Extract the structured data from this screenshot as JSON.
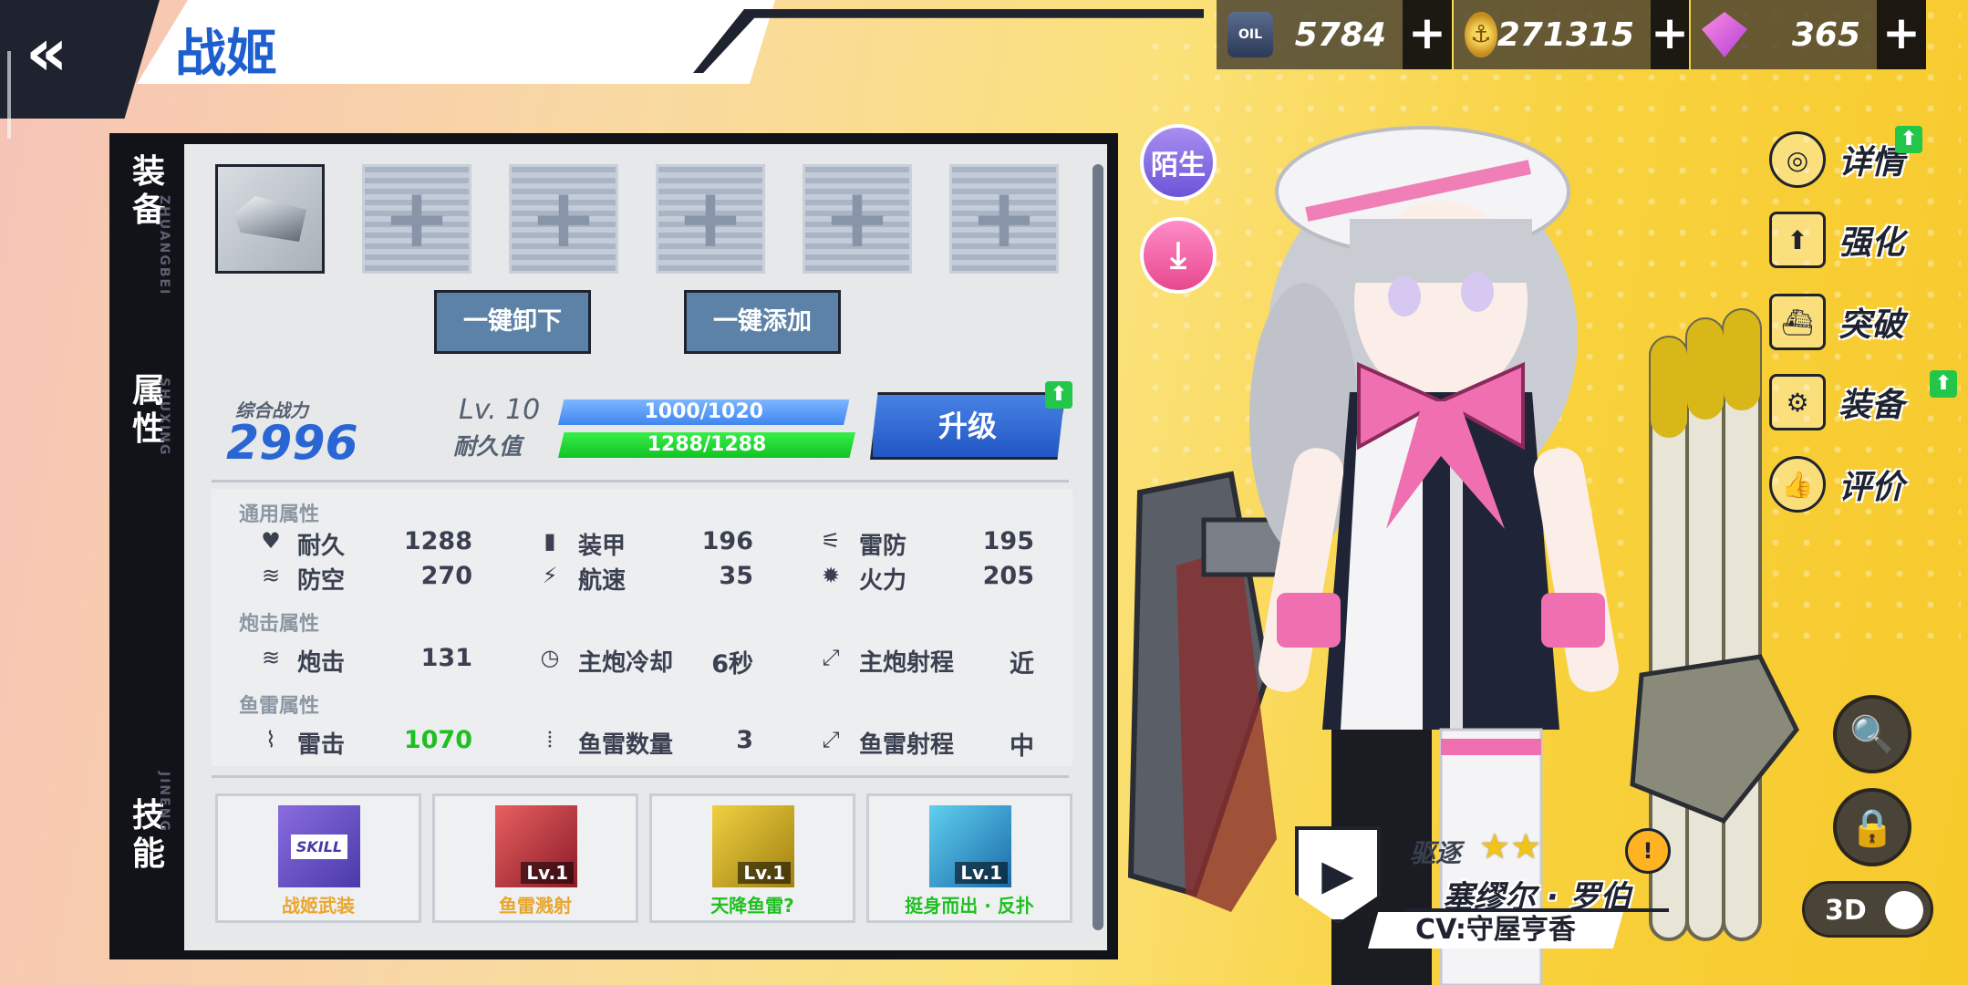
{
  "header": {
    "back_icon": "«",
    "title": "战姬"
  },
  "currencies": [
    {
      "icon": "oil-barrel-icon",
      "icon_text": "OIL",
      "value": "5784",
      "plus": "+"
    },
    {
      "icon": "gold-coin-icon",
      "icon_text": "⚓",
      "value": "271315",
      "plus": "+"
    },
    {
      "icon": "gem-icon",
      "icon_text": "",
      "value": "365",
      "plus": "+"
    }
  ],
  "side_tabs": [
    {
      "label": "装\n备",
      "pinyin": "ZHUANGBEI"
    },
    {
      "label": "属\n性",
      "pinyin": "SHUXING"
    },
    {
      "label": "技\n能",
      "pinyin": "JINENG"
    }
  ],
  "equipment": {
    "slots": [
      "filled",
      "+",
      "+",
      "+",
      "+",
      "+"
    ],
    "unequip_all": "一键卸下",
    "equip_all": "一键添加"
  },
  "stats_header": {
    "power_label": "综合战力",
    "power_value": "2996",
    "level": "Lv. 10",
    "exp": "1000/1020",
    "exp_fraction": 0.98,
    "durability_label": "耐久值",
    "hp": "1288/1288",
    "hp_fraction": 1.0,
    "upgrade": "升级",
    "arrow": "⬆"
  },
  "stat_groups": {
    "general": {
      "title": "通用属性",
      "rows": [
        [
          {
            "icon": "♥",
            "name": "耐久",
            "value": "1288"
          },
          {
            "icon": "▮",
            "name": "装甲",
            "value": "196"
          },
          {
            "icon": "⚟",
            "name": "雷防",
            "value": "195"
          }
        ],
        [
          {
            "icon": "≋",
            "name": "防空",
            "value": "270"
          },
          {
            "icon": "⚡",
            "name": "航速",
            "value": "35"
          },
          {
            "icon": "✹",
            "name": "火力",
            "value": "205"
          }
        ]
      ]
    },
    "gun": {
      "title": "炮击属性",
      "rows": [
        [
          {
            "icon": "≋",
            "name": "炮击",
            "value": "131"
          },
          {
            "icon": "◷",
            "name": "主炮冷却",
            "value": "6秒"
          },
          {
            "icon": "⤢",
            "name": "主炮射程",
            "value": "近"
          }
        ]
      ]
    },
    "torpedo": {
      "title": "鱼雷属性",
      "rows": [
        [
          {
            "icon": "⌇",
            "name": "雷击",
            "value": "1070"
          },
          {
            "icon": "⦙",
            "name": "鱼雷数量",
            "value": "3"
          },
          {
            "icon": "⤢",
            "name": "鱼雷射程",
            "value": "中"
          }
        ]
      ]
    }
  },
  "skills": [
    {
      "name": "战姬武装",
      "lv": "",
      "icon_text": "SKILL",
      "name_color": "#e8a62e"
    },
    {
      "name": "鱼雷溅射",
      "lv": "Lv.1",
      "icon_text": "",
      "name_color": "#e8a62e"
    },
    {
      "name": "天降鱼雷?",
      "lv": "Lv.1",
      "icon_text": "",
      "name_color": "#1fbf22"
    },
    {
      "name": "挺身而出 · 反扑",
      "lv": "Lv.1",
      "icon_text": "",
      "name_color": "#1fbf22"
    }
  ],
  "side_buttons": {
    "stranger": "陌生",
    "share_icon": "⤓"
  },
  "right_menu": [
    {
      "icon": "target-icon",
      "glyph": "◎",
      "label": "详情"
    },
    {
      "icon": "enhance-icon",
      "glyph": "⬆",
      "label": "强化"
    },
    {
      "icon": "breakthrough-icon",
      "glyph": "⛴",
      "label": "突破"
    },
    {
      "icon": "equipment-icon",
      "glyph": "⚙",
      "label": "装备"
    },
    {
      "icon": "rating-icon",
      "glyph": "👍",
      "label": "评价"
    }
  ],
  "right_controls": {
    "zoom_icon": "🔍",
    "lock_icon": "🔒",
    "mode_3d": "3D"
  },
  "character": {
    "ship_type": "驱逐",
    "stars": "★★",
    "name": "塞缪尔 · 罗伯",
    "cv": "CV:守屋亨香",
    "play_icon": "▶",
    "emoji_icon": "😣"
  }
}
